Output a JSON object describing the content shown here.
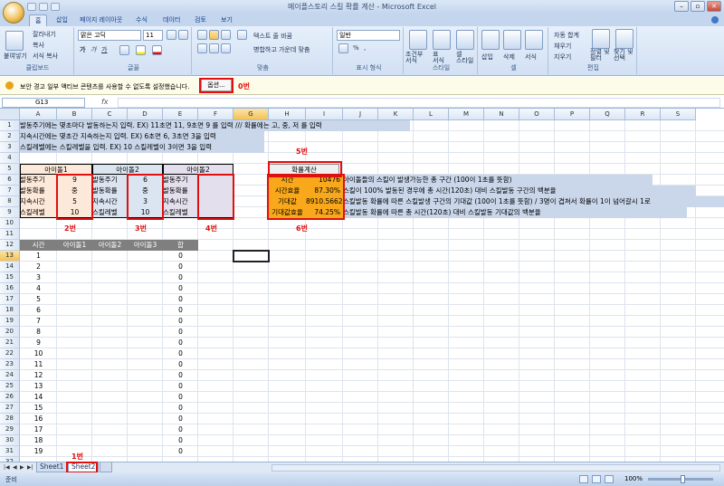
{
  "window": {
    "title": "메이플스토리 스킬 확률 계산 - Microsoft Excel"
  },
  "ribbon": {
    "tabs": [
      "홈",
      "삽입",
      "페이지 레이아웃",
      "수식",
      "데이터",
      "검토",
      "보기"
    ],
    "clipboard": {
      "paste": "붙여넣기",
      "cut": "잘라내기",
      "copy": "복사",
      "format_painter": "서식 복사",
      "label": "클립보드"
    },
    "font": {
      "name": "맑은 고딕",
      "size": "11",
      "label": "글꼴",
      "bold": "가",
      "italic": "가",
      "underline": "가"
    },
    "alignment": {
      "wrap": "텍스트 줄 바꿈",
      "merge": "병합하고 가운데 맞춤",
      "label": "맞춤"
    },
    "number": {
      "format": "일반",
      "label": "표시 형식",
      "percent": "%",
      "comma": ","
    },
    "styles": {
      "conditional": "조건부\n서식",
      "table": "표\n서식",
      "cell": "셀\n스타일",
      "label": "스타일"
    },
    "cells": {
      "insert": "삽입",
      "delete": "삭제",
      "format": "서식",
      "label": "셀"
    },
    "editing": {
      "autosum": "자동 합계",
      "fill": "채우기",
      "clear": "지우기",
      "sort": "정렬 및\n필터",
      "find": "찾기 및\n선택",
      "label": "편집"
    }
  },
  "warning": {
    "text": "보안 경고   일부 액티브 콘텐츠를 사용할 수 없도록 설정했습니다.",
    "option_button": "옵션...",
    "annotation": "0번"
  },
  "formula_bar": {
    "name_box": "G13",
    "fx": "fx",
    "formula": ""
  },
  "sheet": {
    "columns": [
      "A",
      "B",
      "C",
      "D",
      "E",
      "F",
      "G",
      "H",
      "I",
      "J",
      "K",
      "L",
      "M",
      "N",
      "O",
      "P",
      "Q",
      "R",
      "S"
    ],
    "rows": [
      "1",
      "2",
      "3",
      "4",
      "5",
      "6",
      "7",
      "8",
      "9",
      "10",
      "11",
      "12",
      "13",
      "14",
      "15",
      "16",
      "17",
      "18",
      "19",
      "20",
      "21",
      "22",
      "23",
      "24",
      "25",
      "26",
      "27",
      "28",
      "29",
      "30",
      "31",
      "32"
    ],
    "selected_column": "G",
    "selected_row": "13",
    "notes": [
      "발동주기에는 몇초마다 발동하는지 입력. EX) 11초면 11, 9초면 9 를 입력  ///  확률에는 고, 중, 저 를 입력",
      "지속시간에는 몇초간 지속하는지 입력. EX) 6초면 6, 3초면 3을 입력",
      "스킬레벨에는 스킬레벨을 입력. EX) 10  스킬레벨이 3이면 3을 입력"
    ],
    "idols": [
      {
        "header": "아이돌1",
        "labels": [
          "발동주기",
          "발동확률",
          "지속시간",
          "스킬레벨"
        ],
        "values": [
          "9",
          "중",
          "5",
          "10"
        ],
        "annotation": "2번"
      },
      {
        "header": "아이돌2",
        "labels": [
          "발동주기",
          "발동확률",
          "지속시간",
          "스킬레벨"
        ],
        "values": [
          "6",
          "중",
          "3",
          "10"
        ],
        "annotation": "3번"
      },
      {
        "header": "아이돌2",
        "labels": [
          "발동주기",
          "발동확률",
          "지속시간",
          "스킬레벨"
        ],
        "values": [
          "",
          "",
          "",
          ""
        ],
        "annotation": "4번"
      }
    ],
    "calc_button": {
      "label": "확률계산",
      "annotation": "5번"
    },
    "results": {
      "labels": [
        "시간",
        "시간효율",
        "기대값",
        "기대값효율"
      ],
      "values": [
        "10476",
        "87.30%",
        "8910.5662",
        "74.25%"
      ],
      "descriptions": [
        "아이돌들의 스킬이 발생가능한 총 구간 (100이 1초를 뜻함)",
        "스킬이 100% 발동된 경우에 총 시간(120초) 대비 스킬발동 구간의 백분율",
        "스킬발동 확률에 따른 스킬발생 구간의 기대값 (100이 1초를 뜻함) / 3명이 겹쳐서 확률이 1이 넘어갈시 1로",
        "스킬발동 확률에 따른 총 시간(120초) 대비 스킬발동 기대값의 백분율"
      ],
      "annotation": "6번"
    },
    "table_headers": [
      "시간",
      "아이돌1",
      "아이돌2",
      "아이돌3",
      "합"
    ],
    "time_values": [
      "1",
      "2",
      "3",
      "4",
      "5",
      "6",
      "7",
      "8",
      "9",
      "10",
      "11",
      "12",
      "13",
      "14",
      "15",
      "16",
      "17",
      "18",
      "19"
    ],
    "sum_values": [
      "0",
      "0",
      "0",
      "0",
      "0",
      "0",
      "0",
      "0",
      "0",
      "0",
      "0",
      "0",
      "0",
      "0",
      "0",
      "0",
      "0",
      "0",
      "0"
    ]
  },
  "sheet_tabs": {
    "tabs": [
      "Sheet1",
      "Sheet2"
    ],
    "active": "Sheet2",
    "annotation": "1번"
  },
  "status": {
    "text": "준비",
    "zoom": "100%"
  },
  "colors": {
    "accent_red": "#e01010",
    "highlight_yellow": "#f8a81a",
    "desc_fill": "#cad7eb",
    "idol_fill_1": "#fde9d9",
    "idol_fill_2": "#dbe5f1",
    "idol_fill_3": "#e4dfec"
  }
}
